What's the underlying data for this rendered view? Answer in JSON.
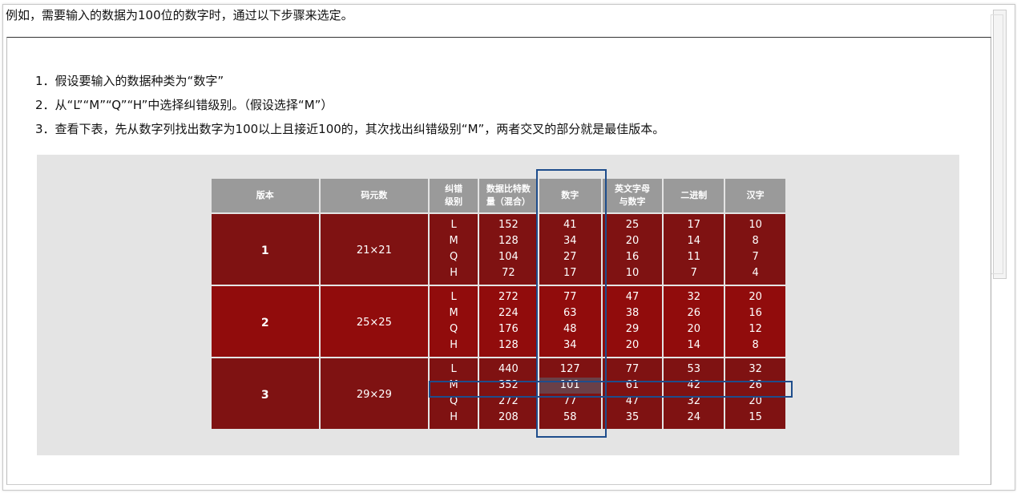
{
  "intro": "例如，需要输入的数据为100位的数字时，通过以下步骤来选定。",
  "steps": [
    "1．假设要输入的数据种类为“数字”",
    "2．从“L”“M”“Q”“H”中选择纠错级别。（假设选择“M”）",
    "3．查看下表，先从数字列找出数字为100以上且接近100的，其次找出纠错级别“M”，两者交叉的部分就是最佳版本。"
  ],
  "table": {
    "headers": {
      "version": "版本",
      "modules": "码元数",
      "ecl_1": "纠错",
      "ecl_2": "级别",
      "bits_1": "数据比特数",
      "bits_2": "量（混合）",
      "numeric": "数字",
      "alnum_1": "英文字母",
      "alnum_2": "与数字",
      "binary": "二进制",
      "kanji": "汉字"
    },
    "groups": [
      {
        "version": "1",
        "modules": "21×21",
        "rows": [
          {
            "ecl": "L",
            "bits": "152",
            "numeric": "41",
            "alnum": "25",
            "binary": "17",
            "kanji": "10"
          },
          {
            "ecl": "M",
            "bits": "128",
            "numeric": "34",
            "alnum": "20",
            "binary": "14",
            "kanji": "8"
          },
          {
            "ecl": "Q",
            "bits": "104",
            "numeric": "27",
            "alnum": "16",
            "binary": "11",
            "kanji": "7"
          },
          {
            "ecl": "H",
            "bits": "72",
            "numeric": "17",
            "alnum": "10",
            "binary": "7",
            "kanji": "4"
          }
        ]
      },
      {
        "version": "2",
        "modules": "25×25",
        "rows": [
          {
            "ecl": "L",
            "bits": "272",
            "numeric": "77",
            "alnum": "47",
            "binary": "32",
            "kanji": "20"
          },
          {
            "ecl": "M",
            "bits": "224",
            "numeric": "63",
            "alnum": "38",
            "binary": "26",
            "kanji": "16"
          },
          {
            "ecl": "Q",
            "bits": "176",
            "numeric": "48",
            "alnum": "29",
            "binary": "20",
            "kanji": "12"
          },
          {
            "ecl": "H",
            "bits": "128",
            "numeric": "34",
            "alnum": "20",
            "binary": "14",
            "kanji": "8"
          }
        ]
      },
      {
        "version": "3",
        "modules": "29×29",
        "rows": [
          {
            "ecl": "L",
            "bits": "440",
            "numeric": "127",
            "alnum": "77",
            "binary": "53",
            "kanji": "32"
          },
          {
            "ecl": "M",
            "bits": "352",
            "numeric": "101",
            "alnum": "61",
            "binary": "42",
            "kanji": "26"
          },
          {
            "ecl": "Q",
            "bits": "272",
            "numeric": "77",
            "alnum": "47",
            "binary": "32",
            "kanji": "20"
          },
          {
            "ecl": "H",
            "bits": "208",
            "numeric": "58",
            "alnum": "35",
            "binary": "24",
            "kanji": "15"
          }
        ]
      }
    ]
  },
  "colors": {
    "header_bg": "#9a9a9a",
    "row_dark_red": "#7f1212",
    "row_red": "#910c0c",
    "highlight_box": "#1e4d8c",
    "highlight_cell": "#6a4048"
  }
}
